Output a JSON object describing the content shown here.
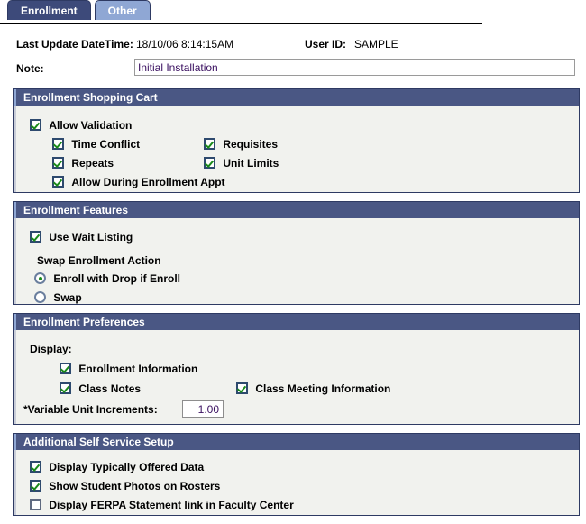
{
  "tabs": [
    {
      "label": "Enrollment",
      "active": true
    },
    {
      "label": "Other",
      "active": false
    }
  ],
  "header": {
    "last_update_label": "Last Update DateTime:",
    "last_update_value": "18/10/06  8:14:15AM",
    "user_id_label": "User ID:",
    "user_id_value": "SAMPLE",
    "note_label": "Note:",
    "note_value": "Initial Installation",
    "note_placeholder": ""
  },
  "shopping_cart": {
    "title": "Enrollment Shopping Cart",
    "allow_validation": "Allow Validation",
    "time_conflict": "Time Conflict",
    "requisites": "Requisites",
    "repeats": "Repeats",
    "unit_limits": "Unit Limits",
    "allow_during_appt": "Allow During Enrollment Appt"
  },
  "features": {
    "title": "Enrollment Features",
    "use_wait_listing": "Use Wait Listing",
    "swap_action_label": "Swap Enrollment Action",
    "option_enroll_with_drop": "Enroll with Drop if Enroll",
    "option_swap": "Swap"
  },
  "preferences": {
    "title": "Enrollment Preferences",
    "display_label": "Display:",
    "enrollment_information": "Enrollment Information",
    "class_notes": "Class Notes",
    "class_meeting_information": "Class Meeting Information",
    "variable_unit_label": "*Variable Unit Increments:",
    "variable_unit_value": "1.00"
  },
  "self_service": {
    "title": "Additional Self Service Setup",
    "display_typically_offered": "Display Typically Offered Data",
    "show_student_photos": "Show Student Photos on Rosters",
    "display_ferpa": "Display FERPA Statement link in Faculty Center"
  },
  "colors": {
    "tab_active": "#3d4a7a",
    "tab_inactive": "#8fa7d4",
    "group_header": "#4a5784",
    "group_body": "#f1f2ee",
    "border": "#2e3a63",
    "check_green": "#1a8a1a",
    "input_text": "#3a1060"
  }
}
